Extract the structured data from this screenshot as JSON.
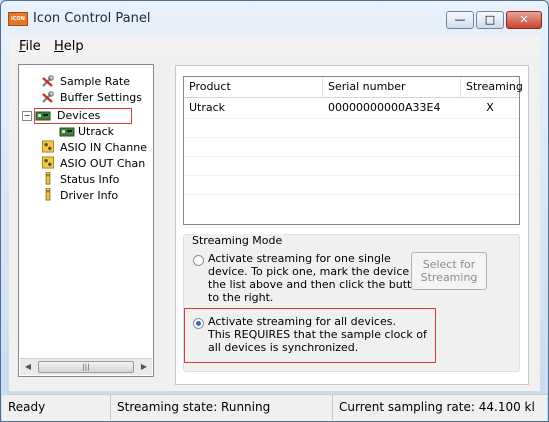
{
  "window": {
    "title": "Icon Control Panel",
    "app_icon_text": "ICON",
    "min_symbol": "—",
    "max_symbol": "□",
    "close_symbol": "✕"
  },
  "menu": {
    "file": "File",
    "help": "Help"
  },
  "tree": {
    "items": [
      {
        "label": "Sample Rate",
        "icon": "tools-icon"
      },
      {
        "label": "Buffer Settings",
        "icon": "tools-icon"
      },
      {
        "label": "Devices",
        "icon": "device-board-icon",
        "expander": "−"
      },
      {
        "label": "Utrack",
        "icon": "device-board-icon"
      },
      {
        "label": "ASIO IN Channe",
        "icon": "channel-icon"
      },
      {
        "label": "ASIO OUT Chan",
        "icon": "channel-icon"
      },
      {
        "label": "Status Info",
        "icon": "info-icon"
      },
      {
        "label": "Driver Info",
        "icon": "info-icon"
      }
    ],
    "scroll_left": "◀",
    "scroll_right": "▶",
    "scroll_grip": "|||"
  },
  "table": {
    "columns": [
      "Product",
      "Serial number",
      "Streaming"
    ],
    "rows": [
      {
        "product": "Utrack",
        "serial": "00000000000A33E4",
        "streaming": "X"
      }
    ]
  },
  "streaming_mode": {
    "title": "Streaming Mode",
    "option1_lines": [
      "Activate streaming for one single",
      "device. To pick one, mark the device in",
      "the list above and then click the button",
      "to the right."
    ],
    "option2_lines": [
      "Activate streaming for all devices.",
      "This REQUIRES that the sample clock of",
      "all devices is synchronized."
    ],
    "select_button_lines": [
      "Select for",
      "Streaming"
    ],
    "selected_option": 2
  },
  "status": {
    "ready": "Ready",
    "state": "Streaming state: Running",
    "rate": "Current sampling rate: 44.100 kl"
  },
  "colors": {
    "highlight_border": "#d93a3a",
    "title_bar_close": "#c7442f"
  }
}
